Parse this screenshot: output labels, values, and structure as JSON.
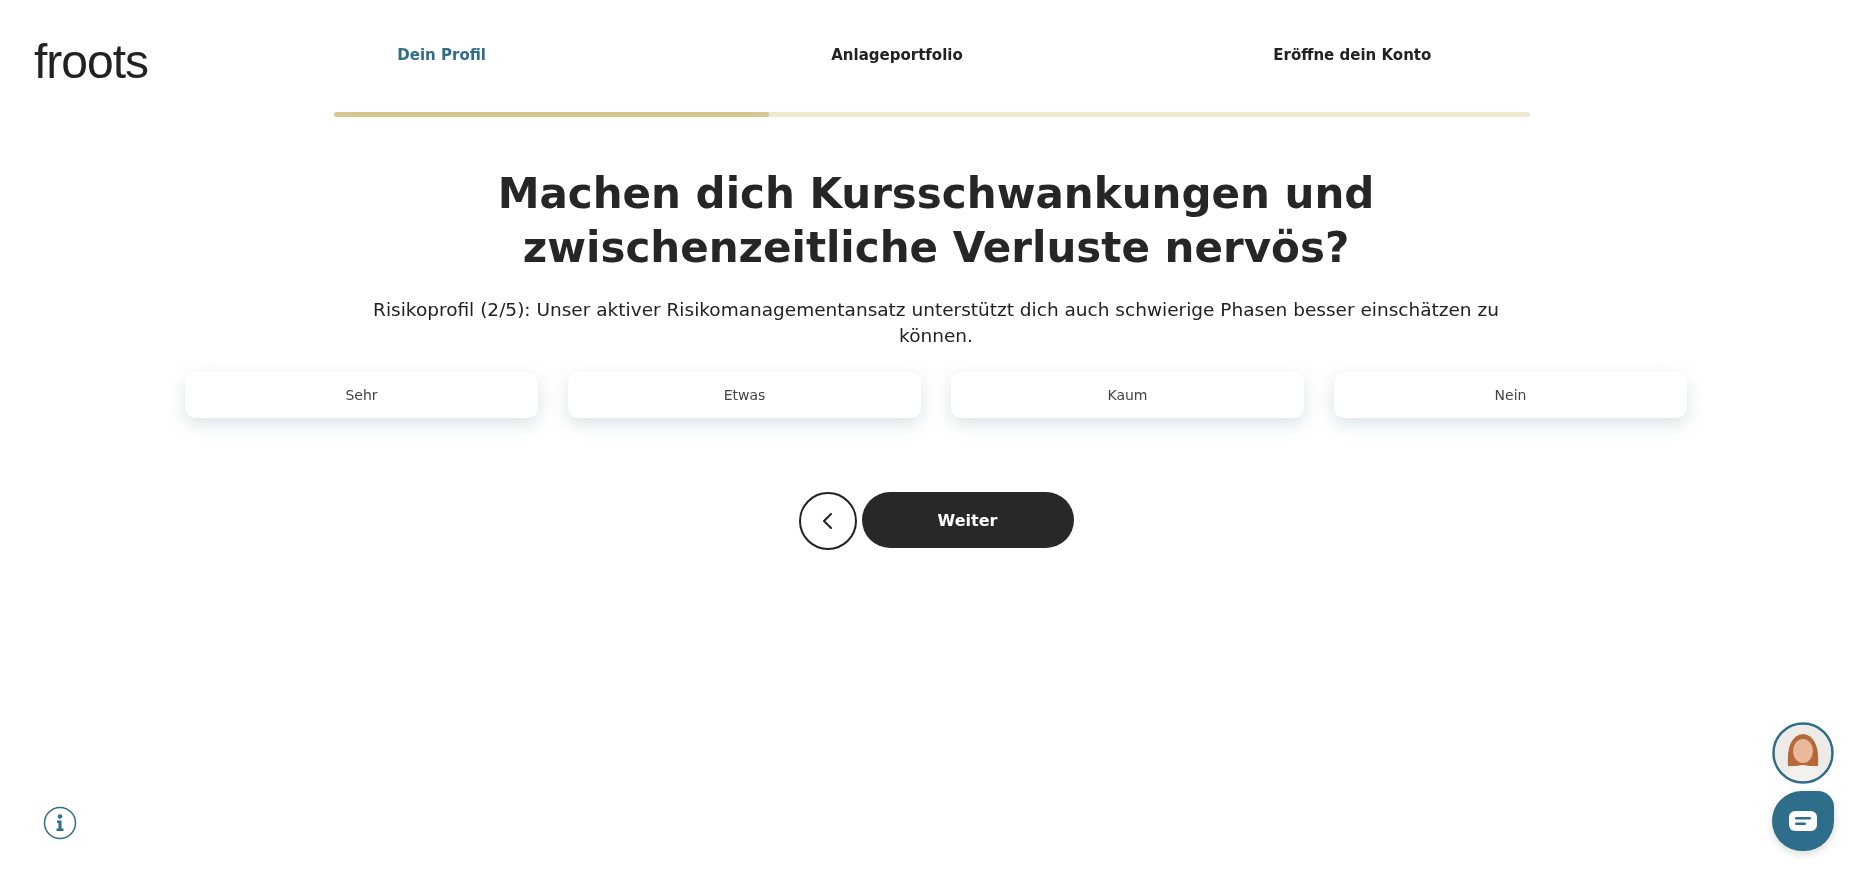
{
  "logo": "froots",
  "steps": [
    {
      "label": "Dein Profil",
      "selected": true
    },
    {
      "label": "Anlageportfolio",
      "selected": false
    },
    {
      "label": "Eröffne dein Konto",
      "selected": false
    }
  ],
  "progress": {
    "level": 0.364
  },
  "question": {
    "title": "Machen dich Kursschwankungen und zwischenzeitliche Verluste nervös?",
    "subtitle": "Risikoprofil (2/5): Unser aktiver Risikomanagementansatz unterstützt dich auch schwierige Phasen besser einschätzen zu können."
  },
  "options": [
    {
      "label": "Sehr",
      "selected": false
    },
    {
      "label": "Etwas",
      "selected": false
    },
    {
      "label": "Kaum",
      "selected": false
    },
    {
      "label": "Nein",
      "selected": false
    }
  ],
  "next_button": "Weiter"
}
